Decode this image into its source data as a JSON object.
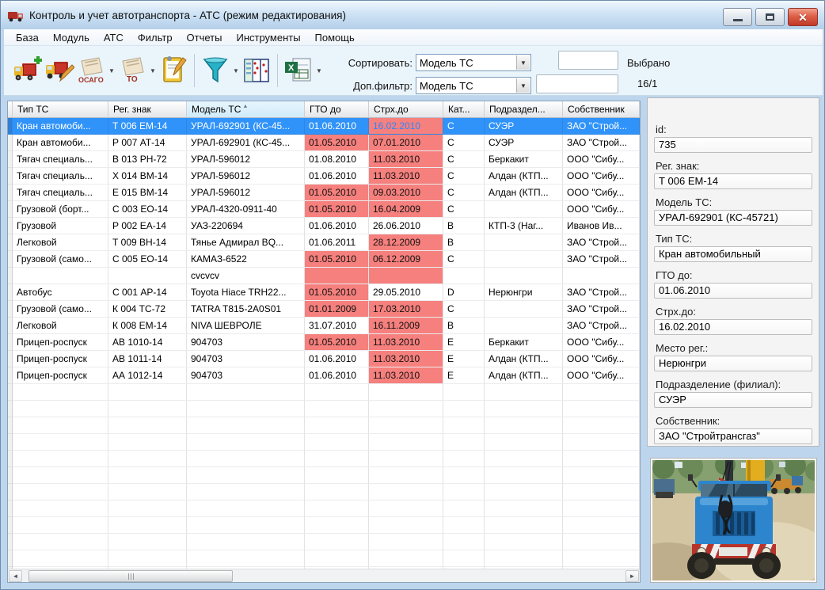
{
  "titlebar": {
    "title": "Контроль и учет автотранспорта - АТС  (режим редактирования)"
  },
  "menu": {
    "items": [
      "База",
      "Модуль",
      "АТС",
      "Фильтр",
      "Отчеты",
      "Инструменты",
      "Помощь"
    ]
  },
  "toolbar": {
    "osago_label": "ОСАГО",
    "to_label": "ТО",
    "sort_label": "Сортировать:",
    "sort_value": "Модель ТС",
    "filter_label": "Доп.фильтр:",
    "filter_value": "Модель ТС",
    "sort_input_value": "",
    "filter_input_value": "",
    "selected_label": "Выбрано",
    "selected_count": "16/1"
  },
  "table": {
    "columns": [
      {
        "label": "Тип ТС",
        "width": 121
      },
      {
        "label": "Рег. знак",
        "width": 99
      },
      {
        "label": "Модель ТС",
        "width": 149,
        "sorted": true
      },
      {
        "label": "ГТО до",
        "width": 81
      },
      {
        "label": "Стрх.до",
        "width": 94
      },
      {
        "label": "Кат...",
        "width": 52
      },
      {
        "label": "Подраздел...",
        "width": 99
      },
      {
        "label": "Собственник",
        "width": 97
      }
    ],
    "rows": [
      {
        "selected": true,
        "red_cells": [
          4
        ],
        "cells": [
          "Кран автомоби...",
          "Т 006 ЕМ-14",
          "УРАЛ-692901 (КС-45...",
          "01.06.2010",
          "16.02.2010",
          "С",
          "СУЭР",
          "ЗАО \"Строй..."
        ]
      },
      {
        "selected": false,
        "red_cells": [
          3,
          4
        ],
        "cells": [
          "Кран автомоби...",
          "Р 007 АТ-14",
          "УРАЛ-692901 (КС-45...",
          "01.05.2010",
          "07.01.2010",
          "С",
          "СУЭР",
          "ЗАО \"Строй..."
        ]
      },
      {
        "selected": false,
        "red_cells": [
          4
        ],
        "cells": [
          "Тягач специаль...",
          "В 013 РН-72",
          "УРАЛ-596012",
          "01.08.2010",
          "11.03.2010",
          "С",
          "Беркакит",
          "ООО \"Сибу..."
        ]
      },
      {
        "selected": false,
        "red_cells": [
          4
        ],
        "cells": [
          "Тягач специаль...",
          "Х 014 ВМ-14",
          "УРАЛ-596012",
          "01.06.2010",
          "11.03.2010",
          "С",
          "Алдан (КТП...",
          "ООО \"Сибу..."
        ]
      },
      {
        "selected": false,
        "red_cells": [
          3,
          4
        ],
        "cells": [
          "Тягач специаль...",
          "Е 015 ВМ-14",
          "УРАЛ-596012",
          "01.05.2010",
          "09.03.2010",
          "С",
          "Алдан (КТП...",
          "ООО \"Сибу..."
        ]
      },
      {
        "selected": false,
        "red_cells": [
          3,
          4
        ],
        "cells": [
          "Грузовой (борт...",
          "С 003 ЕО-14",
          "УРАЛ-4320-0911-40",
          "01.05.2010",
          "16.04.2009",
          "С",
          "",
          "ООО \"Сибу..."
        ]
      },
      {
        "selected": false,
        "red_cells": [],
        "cells": [
          "Грузовой",
          "Р 002 ЕА-14",
          "УАЗ-220694",
          "01.06.2010",
          "26.06.2010",
          "В",
          "КТП-3 (Наг...",
          "Иванов Ив..."
        ]
      },
      {
        "selected": false,
        "red_cells": [
          4
        ],
        "cells": [
          "Легковой",
          "Т 009 ВН-14",
          "Тянье Адмирал BQ...",
          "01.06.2011",
          "28.12.2009",
          "В",
          "",
          "ЗАО \"Строй..."
        ]
      },
      {
        "selected": false,
        "red_cells": [
          3,
          4
        ],
        "cells": [
          "Грузовой (само...",
          "С 005 ЕО-14",
          "КАМАЗ-6522",
          "01.05.2010",
          "06.12.2009",
          "С",
          "",
          "ЗАО \"Строй..."
        ]
      },
      {
        "selected": false,
        "red_cells": [
          3,
          4
        ],
        "cells": [
          "",
          "",
          "cvcvcv",
          "",
          "",
          "",
          "",
          ""
        ]
      },
      {
        "selected": false,
        "red_cells": [
          3
        ],
        "cells": [
          "Автобус",
          "С 001 АР-14",
          "Toyota Hiace TRH22...",
          "01.05.2010",
          "29.05.2010",
          "D",
          "Нерюнгри",
          "ЗАО \"Строй..."
        ]
      },
      {
        "selected": false,
        "red_cells": [
          3,
          4
        ],
        "cells": [
          "Грузовой (само...",
          "К 004 ТС-72",
          "TATRA T815-2A0S01",
          "01.01.2009",
          "17.03.2010",
          "С",
          "",
          "ЗАО \"Строй..."
        ]
      },
      {
        "selected": false,
        "red_cells": [
          4
        ],
        "cells": [
          "Легковой",
          "К 008 ЕМ-14",
          "NIVA ШЕВРОЛЕ",
          "31.07.2010",
          "16.11.2009",
          "В",
          "",
          "ЗАО \"Строй..."
        ]
      },
      {
        "selected": false,
        "red_cells": [
          3,
          4
        ],
        "cells": [
          "Прицеп-роспуск",
          "АВ 1010-14",
          "904703",
          "01.05.2010",
          "11.03.2010",
          "Е",
          "Беркакит",
          "ООО \"Сибу..."
        ]
      },
      {
        "selected": false,
        "red_cells": [
          4
        ],
        "cells": [
          "Прицеп-роспуск",
          "АВ 1011-14",
          "904703",
          "01.06.2010",
          "11.03.2010",
          "Е",
          "Алдан (КТП...",
          "ООО \"Сибу..."
        ]
      },
      {
        "selected": false,
        "red_cells": [
          4
        ],
        "cells": [
          "Прицеп-роспуск",
          "АА 1012-14",
          "904703",
          "01.06.2010",
          "11.03.2010",
          "Е",
          "Алдан (КТП...",
          "ООО \"Сибу..."
        ]
      }
    ],
    "empty_row_count": 12
  },
  "details": {
    "fields": [
      {
        "label": "id:",
        "value": "735"
      },
      {
        "label": "Рег. знак:",
        "value": "Т 006 ЕМ-14"
      },
      {
        "label": "Модель ТС:",
        "value": "УРАЛ-692901 (КС-45721)"
      },
      {
        "label": "Тип ТС:",
        "value": "Кран автомобильный"
      },
      {
        "label": "ГТО до:",
        "value": "01.06.2010"
      },
      {
        "label": "Стрх.до:",
        "value": "16.02.2010"
      },
      {
        "label": "Место рег.:",
        "value": "Нерюнгри"
      },
      {
        "label": "Подразделение (филиал):",
        "value": "СУЭР"
      },
      {
        "label": "Собственник:",
        "value": "ЗАО \"Стройтрансгаз\""
      }
    ]
  },
  "colors": {
    "selection": "#3093fa",
    "expired_cell": "#f5807d",
    "titlebar": "#cfe3f5",
    "close_button": "#c03a27"
  }
}
